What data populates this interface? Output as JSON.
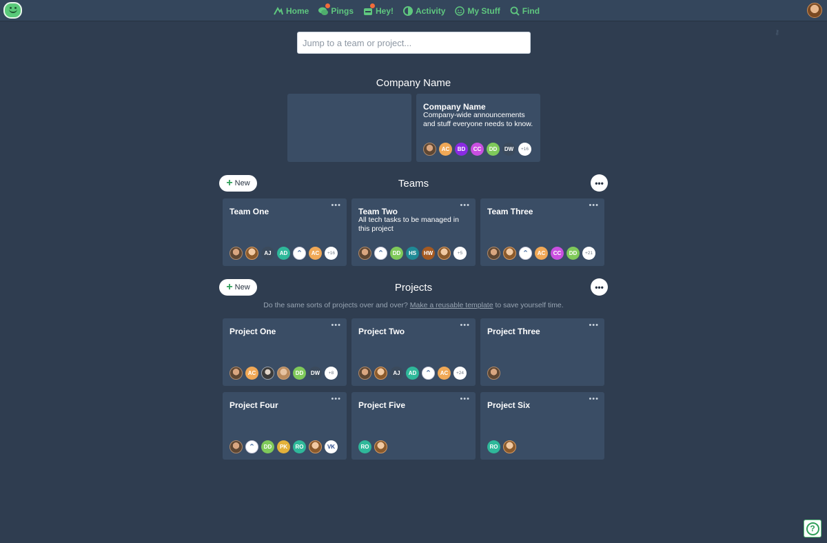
{
  "nav": {
    "items": [
      {
        "label": "Home",
        "icon": "basecamp-mountain-icon"
      },
      {
        "label": "Pings",
        "icon": "chat-bubbles-icon",
        "badge": true
      },
      {
        "label": "Hey!",
        "icon": "inbox-icon",
        "badge": true
      },
      {
        "label": "Activity",
        "icon": "activity-icon"
      },
      {
        "label": "My Stuff",
        "icon": "smiley-icon"
      },
      {
        "label": "Find",
        "icon": "magnifier-icon"
      }
    ]
  },
  "search": {
    "placeholder": "Jump to a team or project..."
  },
  "company": {
    "heading": "Company Name",
    "card": {
      "title": "Company Name",
      "desc": "Company-wide announcements and stuff everyone needs to know.",
      "avatars": [
        "photo",
        "AC",
        "BD",
        "CC",
        "DD",
        "DW",
        "+16"
      ]
    }
  },
  "teams": {
    "heading": "Teams",
    "new_label": "New",
    "dots": "•••",
    "cards": [
      {
        "title": "Team One",
        "desc": "",
        "avatars": [
          "photo",
          "photo",
          "AJ",
          "AD",
          "compass",
          "AC",
          "+16"
        ]
      },
      {
        "title": "Team Two",
        "desc": "All tech tasks to be managed in this project",
        "avatars": [
          "photo",
          "compass",
          "DD",
          "HS",
          "HW",
          "photo",
          "+5"
        ]
      },
      {
        "title": "Team Three",
        "desc": "",
        "avatars": [
          "photo",
          "photo",
          "compass",
          "AC",
          "CC",
          "DD",
          "+21"
        ]
      }
    ]
  },
  "projects": {
    "heading": "Projects",
    "new_label": "New",
    "dots": "•••",
    "note_prefix": "Do the same sorts of projects over and over?",
    "note_link": "Make a reusable template",
    "note_suffix": "to save yourself time.",
    "cards": [
      {
        "title": "Project One",
        "avatars": [
          "photo",
          "AC",
          "photo",
          "photo",
          "DD",
          "DW",
          "+8"
        ]
      },
      {
        "title": "Project Two",
        "avatars": [
          "photo",
          "photo",
          "AJ",
          "AD",
          "compass",
          "AC",
          "+24"
        ]
      },
      {
        "title": "Project Three",
        "avatars": [
          "photo"
        ]
      },
      {
        "title": "Project Four",
        "avatars": [
          "photo",
          "compass",
          "DD",
          "PK",
          "RO",
          "photo",
          "VK"
        ]
      },
      {
        "title": "Project Five",
        "avatars": [
          "RO",
          "photo"
        ]
      },
      {
        "title": "Project Six",
        "avatars": [
          "RO",
          "photo"
        ]
      }
    ]
  },
  "card_more": "•••",
  "help": "?",
  "colors": {
    "background": "#2f3d50",
    "card": "#3a4d65",
    "nav_green": "#5fc77f",
    "AC": "#f0a856",
    "BD": "#8a2be2",
    "CC": "#c94fe0",
    "DD": "#7fc95a",
    "DW": "#3b4a5c",
    "AJ": "#3b4a5c",
    "AD": "#2fb89a",
    "HS": "#1f8a96",
    "HW": "#a55a22",
    "PK": "#e3b13a",
    "RO": "#2fb89a",
    "VK": "#ffffff"
  }
}
